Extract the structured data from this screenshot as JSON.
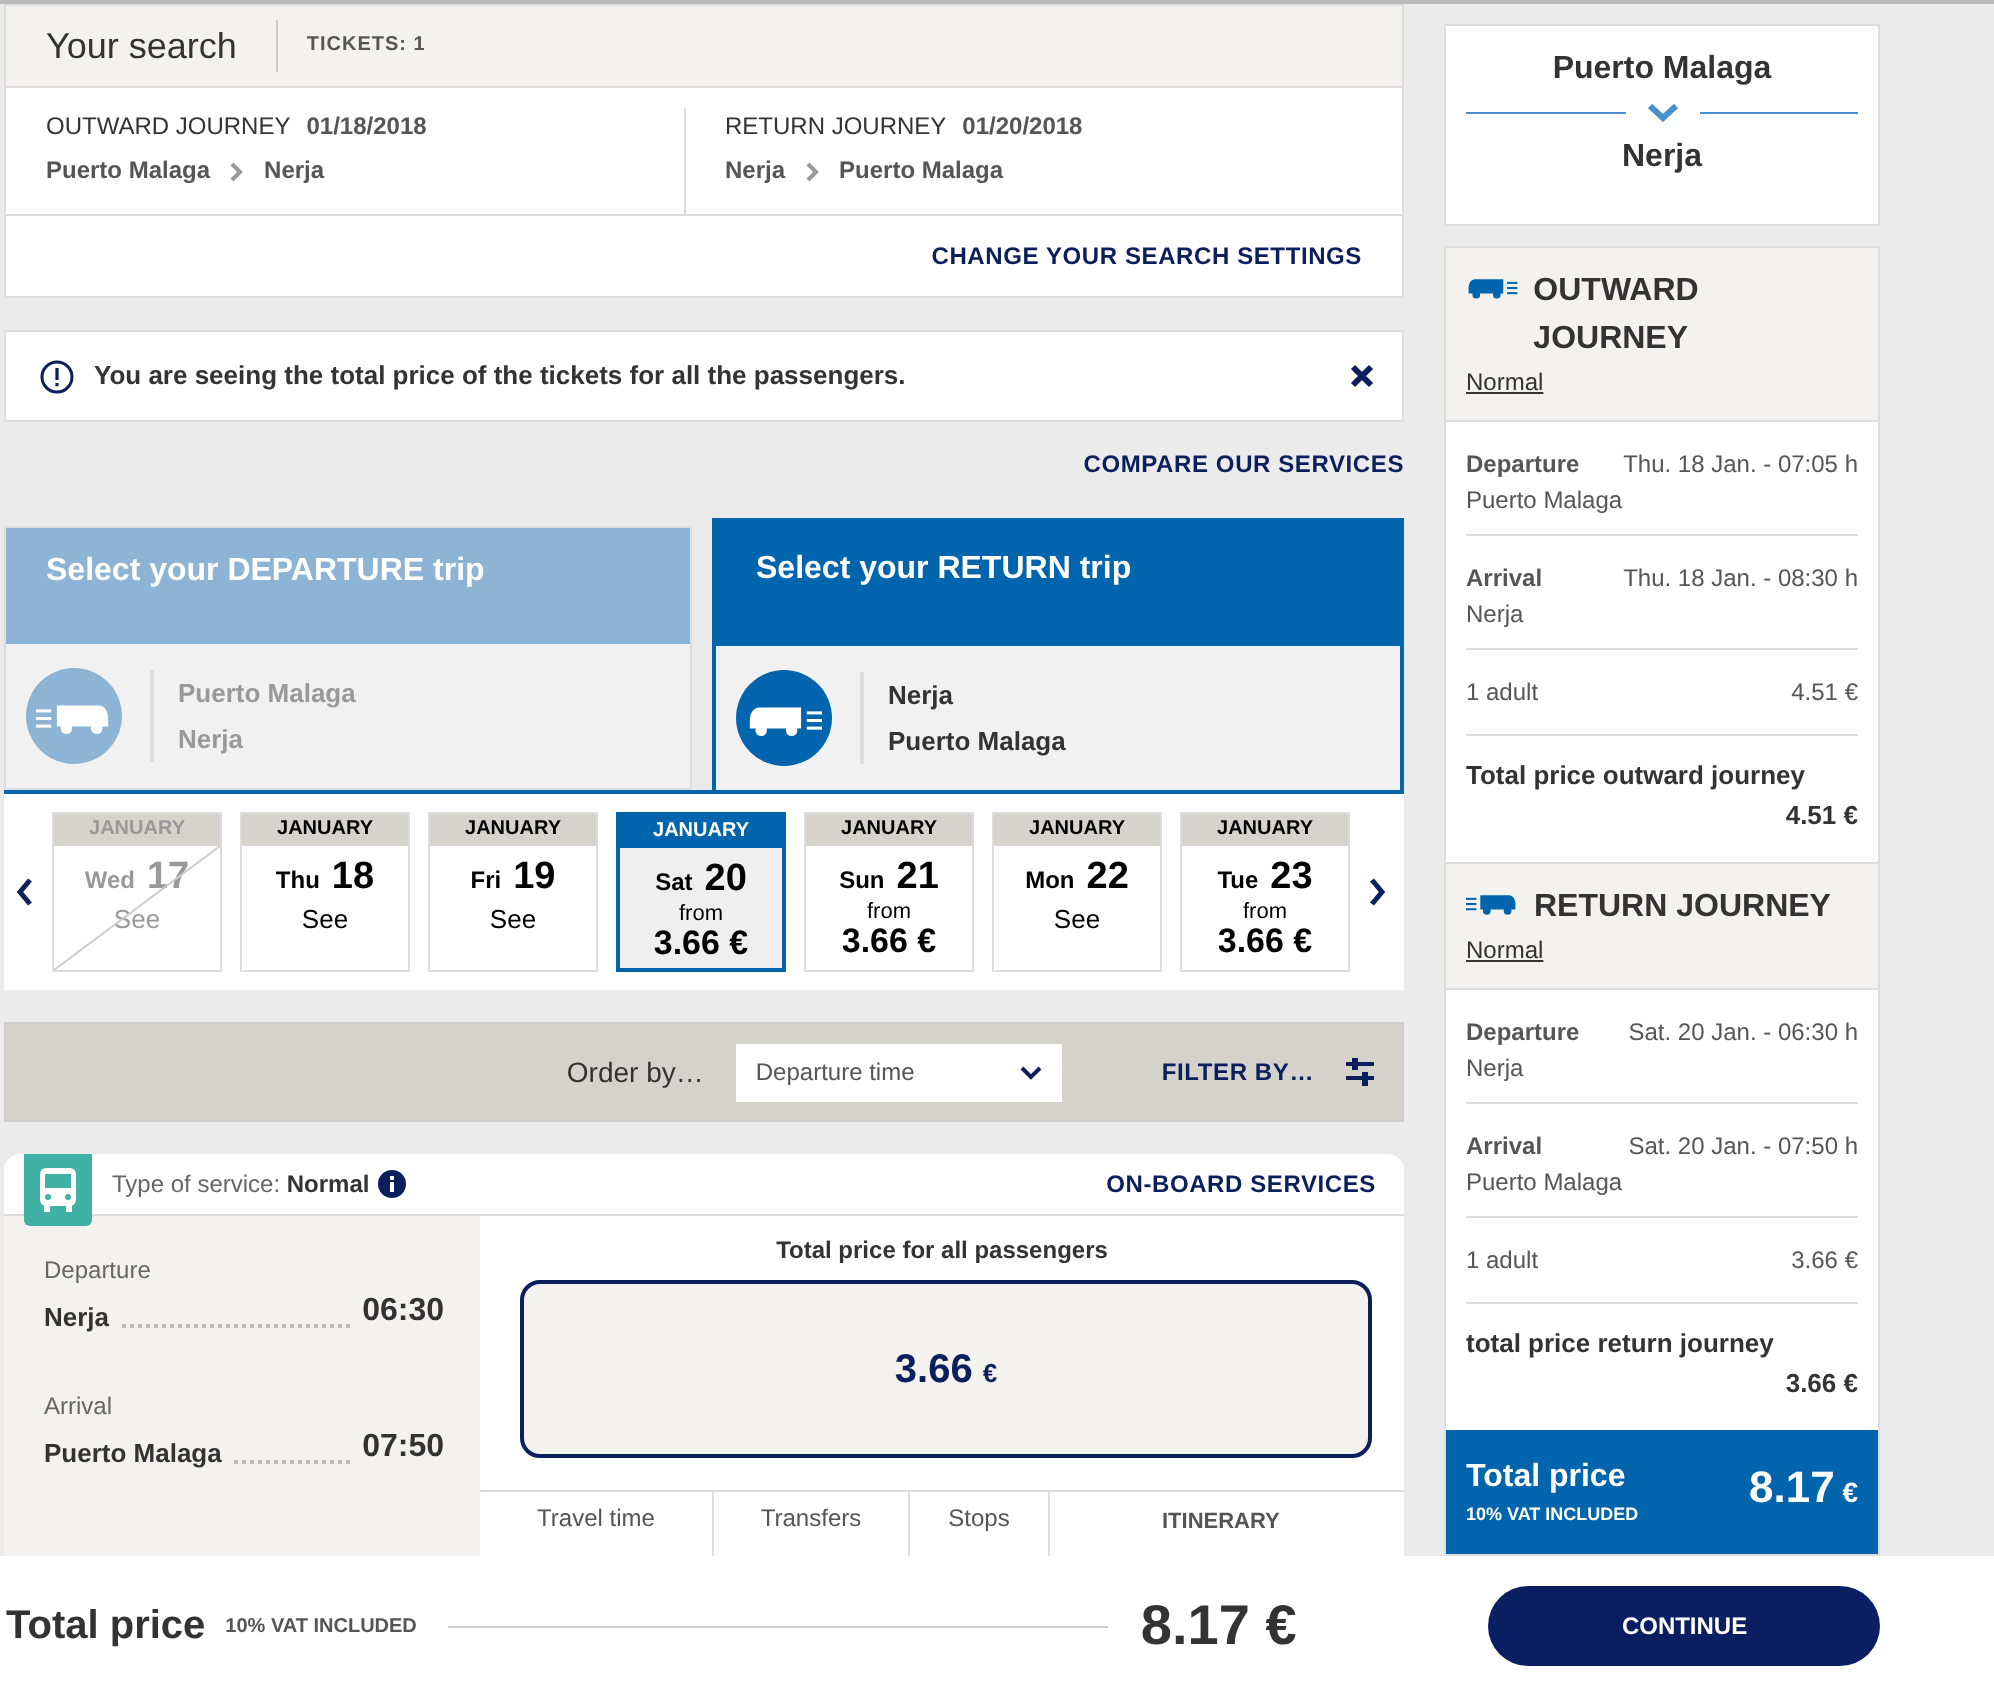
{
  "search": {
    "title": "Your search",
    "tickets": "TICKETS: 1",
    "journeys": [
      {
        "label": "OUTWARD JOURNEY",
        "date": "01/18/2018",
        "from": "Puerto Malaga",
        "to": "Nerja"
      },
      {
        "label": "RETURN JOURNEY",
        "date": "01/20/2018",
        "from": "Nerja",
        "to": "Puerto Malaga"
      }
    ],
    "change_link": "CHANGE YOUR SEARCH SETTINGS"
  },
  "notice": {
    "text": "You are seeing the total price of the tickets for all the passengers."
  },
  "compare_link": "COMPARE OUR SERVICES",
  "trip_tabs": [
    {
      "title": "Select your DEPARTURE trip",
      "stops": [
        "Puerto Malaga",
        "Nerja"
      ],
      "selected": false
    },
    {
      "title": "Select your RETURN trip",
      "stops": [
        "Nerja",
        "Puerto Malaga"
      ],
      "selected": true
    }
  ],
  "dates": [
    {
      "month": "JANUARY",
      "weekday": "Wed",
      "day": "17",
      "kind": "see",
      "note": "See",
      "selected": false,
      "disabled": true
    },
    {
      "month": "JANUARY",
      "weekday": "Thu",
      "day": "18",
      "kind": "see",
      "note": "See",
      "selected": false,
      "disabled": false
    },
    {
      "month": "JANUARY",
      "weekday": "Fri",
      "day": "19",
      "kind": "see",
      "note": "See",
      "selected": false,
      "disabled": false
    },
    {
      "month": "JANUARY",
      "weekday": "Sat",
      "day": "20",
      "kind": "price",
      "note": "from",
      "price": "3.66 €",
      "selected": true,
      "disabled": false
    },
    {
      "month": "JANUARY",
      "weekday": "Sun",
      "day": "21",
      "kind": "price",
      "note": "from",
      "price": "3.66 €",
      "selected": false,
      "disabled": false
    },
    {
      "month": "JANUARY",
      "weekday": "Mon",
      "day": "22",
      "kind": "see",
      "note": "See",
      "selected": false,
      "disabled": false
    },
    {
      "month": "JANUARY",
      "weekday": "Tue",
      "day": "23",
      "kind": "price",
      "note": "from",
      "price": "3.66 €",
      "selected": false,
      "disabled": false
    }
  ],
  "order": {
    "label": "Order by…",
    "value": "Departure time",
    "filter": "FILTER BY…"
  },
  "result": {
    "service_label": "Type of service:",
    "service": "Normal",
    "onboard": "ON-BOARD SERVICES",
    "departure": {
      "label": "Departure",
      "place": "Nerja",
      "time": "06:30"
    },
    "arrival": {
      "label": "Arrival",
      "place": "Puerto Malaga",
      "time": "07:50"
    },
    "price_title": "Total price for all passengers",
    "price": "3.66",
    "currency": "€",
    "columns": [
      "Travel time",
      "Transfers",
      "Stops"
    ],
    "itinerary": "ITINERARY"
  },
  "summary": {
    "from": "Puerto Malaga",
    "to": "Nerja",
    "legs": [
      {
        "kind": "outward",
        "title": "OUTWARD JOURNEY",
        "fare": "Normal",
        "departure": {
          "label": "Departure",
          "date": "Thu. 18 Jan. - 07:05 h",
          "place": "Puerto Malaga"
        },
        "arrival": {
          "label": "Arrival",
          "date": "Thu. 18 Jan. - 08:30 h",
          "place": "Nerja"
        },
        "passengers": "1 adult",
        "amount": "4.51 €",
        "total_label": "Total price outward journey",
        "total": "4.51 €"
      },
      {
        "kind": "return",
        "title": "RETURN JOURNEY",
        "fare": "Normal",
        "departure": {
          "label": "Departure",
          "date": "Sat. 20 Jan. - 06:30 h",
          "place": "Nerja"
        },
        "arrival": {
          "label": "Arrival",
          "date": "Sat. 20 Jan. - 07:50 h",
          "place": "Puerto Malaga"
        },
        "passengers": "1 adult",
        "amount": "3.66 €",
        "total_label": "total price return journey",
        "total": "3.66 €"
      }
    ],
    "total": {
      "label": "Total price",
      "vat": "10% VAT INCLUDED",
      "amount": "8.17",
      "currency": "€"
    }
  },
  "footer": {
    "label": "Total price",
    "vat": "10% VAT INCLUDED",
    "amount": "8.17 €",
    "button": "CONTINUE"
  }
}
